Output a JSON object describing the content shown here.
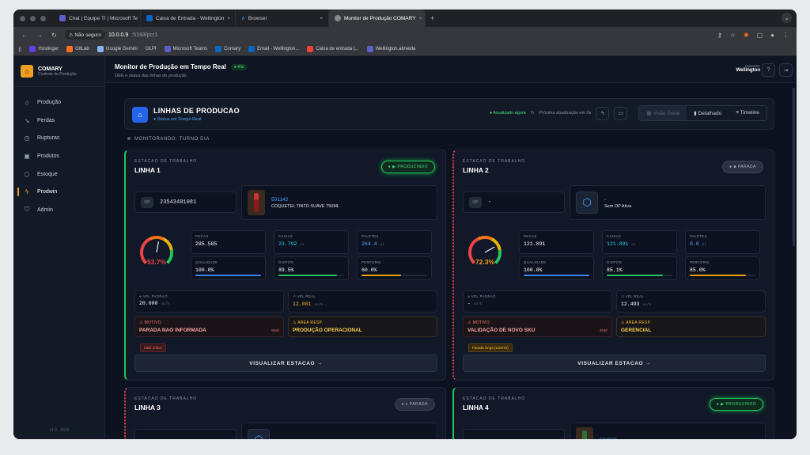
{
  "browser": {
    "tabs": [
      {
        "label": "Chat | Equipe TI | Microsoft Te",
        "color": "#5b5fc7"
      },
      {
        "label": "Caixa de Entrada - Wellington",
        "color": "#0a66c2"
      },
      {
        "label": "Browser",
        "color": "#4aa3ff"
      },
      {
        "label": "Monitor de Produção COMARY",
        "color": "#888888"
      }
    ],
    "security": "Não seguro",
    "url_host": "10.0.0.9",
    "url_path": ":5193/pcr1",
    "bookmarks": [
      "Hostinger",
      "GitLab",
      "Google Gemini",
      "OLPI",
      "Microsoft Teams",
      "Comary",
      "Email - Wellington...",
      "Caixa de entrada (...",
      "Wellington.almeida"
    ]
  },
  "sidebar": {
    "brand": "COMARY",
    "brand_sub": "Controle de Produção",
    "items": [
      {
        "label": "Produção",
        "icon": "factory-icon"
      },
      {
        "label": "Perdas",
        "icon": "trend-down-icon"
      },
      {
        "label": "Rupturas",
        "icon": "clock-icon"
      },
      {
        "label": "Produtos",
        "icon": "box-icon"
      },
      {
        "label": "Estoque",
        "icon": "cube-icon"
      },
      {
        "label": "Prodwin",
        "icon": "bolt-icon"
      },
      {
        "label": "Admin",
        "icon": "shield-icon"
      }
    ],
    "version": "v1.0 · 2025"
  },
  "header": {
    "title": "Monitor de Produção em Tempo Real",
    "live": "● 40s",
    "subtitle": "OEE e status das linhas de produção",
    "operator_label": "Operador",
    "operator_name": "Wellington"
  },
  "panel": {
    "title": "LINHAS DE PRODUCAO",
    "subtitle": "● Status em Tempo Real",
    "updated": "● Atualizado agora",
    "next_update": "Próxima atualização em 0s",
    "views": [
      "Visão Geral",
      "Detalhado",
      "Timeline"
    ]
  },
  "monitoring": "MONITORANDO: TURNO DIA",
  "lines": [
    {
      "station_label": "ESTACAO DE TRABALHO",
      "name": "LINHA 1",
      "status": "● ▶ PRODUZINDO",
      "op_label": "OP",
      "op": "23543481081",
      "product_code": "501142",
      "product_desc": "COQUETEL TINTO SUAVE 750ML",
      "oee": 53.7,
      "oee_text": "53.7%",
      "pecas_label": "PECAS",
      "pecas": "285.585",
      "caixas_label": "CAIXAS",
      "caixas": "23.792",
      "caixas_unit": "cx",
      "paletes_label": "PALETES",
      "paletes": "264.4",
      "paletes_unit": "pl",
      "qual_label": "QUALIDADE",
      "qual": "100.0%",
      "qual_pct": 100,
      "disp_label": "DISPON.",
      "disp": "89.5%",
      "disp_pct": 89.5,
      "perf_label": "PERFORM.",
      "perf": "60.0%",
      "perf_pct": 60,
      "vpadrao_label": "VEL PADRAO",
      "vpadrao": "20.000",
      "vpadrao_unit": "un/h",
      "vreal_label": "VEL REAL",
      "vreal": "12.001",
      "vreal_unit": "un/h ⌄",
      "motivo_label": "⚠ MOTIVO",
      "motivo": "PARADA NAO INFORMADA",
      "motivo_time": "5min",
      "area_label": "⚠ AREA RESP.",
      "area": "PRODUÇÃO OPERACIONAL",
      "chip": "OEE crítico",
      "button": "VISUALIZAR ESTACAO  →"
    },
    {
      "station_label": "ESTACAO DE TRABALHO",
      "name": "LINHA 2",
      "status": "● ■ PARADA",
      "op_label": "OP",
      "op": "-",
      "product_code": "-",
      "product_desc": "Sem OP Ativa",
      "oee": 72.3,
      "oee_text": "72.3%",
      "pecas_label": "PECAS",
      "pecas": "121.891",
      "caixas_label": "CAIXAS",
      "caixas": "121.891",
      "caixas_unit": "cx",
      "paletes_label": "PALETES",
      "paletes": "0.0",
      "paletes_unit": "pl",
      "qual_label": "QUALIDADE",
      "qual": "100.0%",
      "qual_pct": 100,
      "disp_label": "DISPON.",
      "disp": "85.1%",
      "disp_pct": 85.1,
      "perf_label": "PERFORM.",
      "perf": "85.0%",
      "perf_pct": 85,
      "vpadrao_label": "VEL PADRAO",
      "vpadrao": "-",
      "vpadrao_unit": "un/h",
      "vreal_label": "VEL REAL",
      "vreal": "12.493",
      "vreal_unit": "un/h",
      "motivo_label": "⚠ MOTIVO",
      "motivo": "VALIDAÇÃO DE NOVO SKU",
      "motivo_time": "4h40",
      "area_label": "⚠ AREA RESP.",
      "area": "GERENCIAL",
      "chip": "Parada longa (100min)",
      "button": "VISUALIZAR ESTACAO  →"
    },
    {
      "station_label": "ESTACAO DE TRABALHO",
      "name": "LINHA 3",
      "status": "● ⏸ PARADA",
      "product_code": "-"
    },
    {
      "station_label": "ESTACAO DE TRABALHO",
      "name": "LINHA 4",
      "status": "● ▶ PRODUZINDO",
      "product_code": "503030"
    }
  ],
  "colors": {
    "accent": "#f0a01e",
    "running": "#22c55e",
    "stopped": "#ef4444",
    "blue": "#2563eb"
  }
}
